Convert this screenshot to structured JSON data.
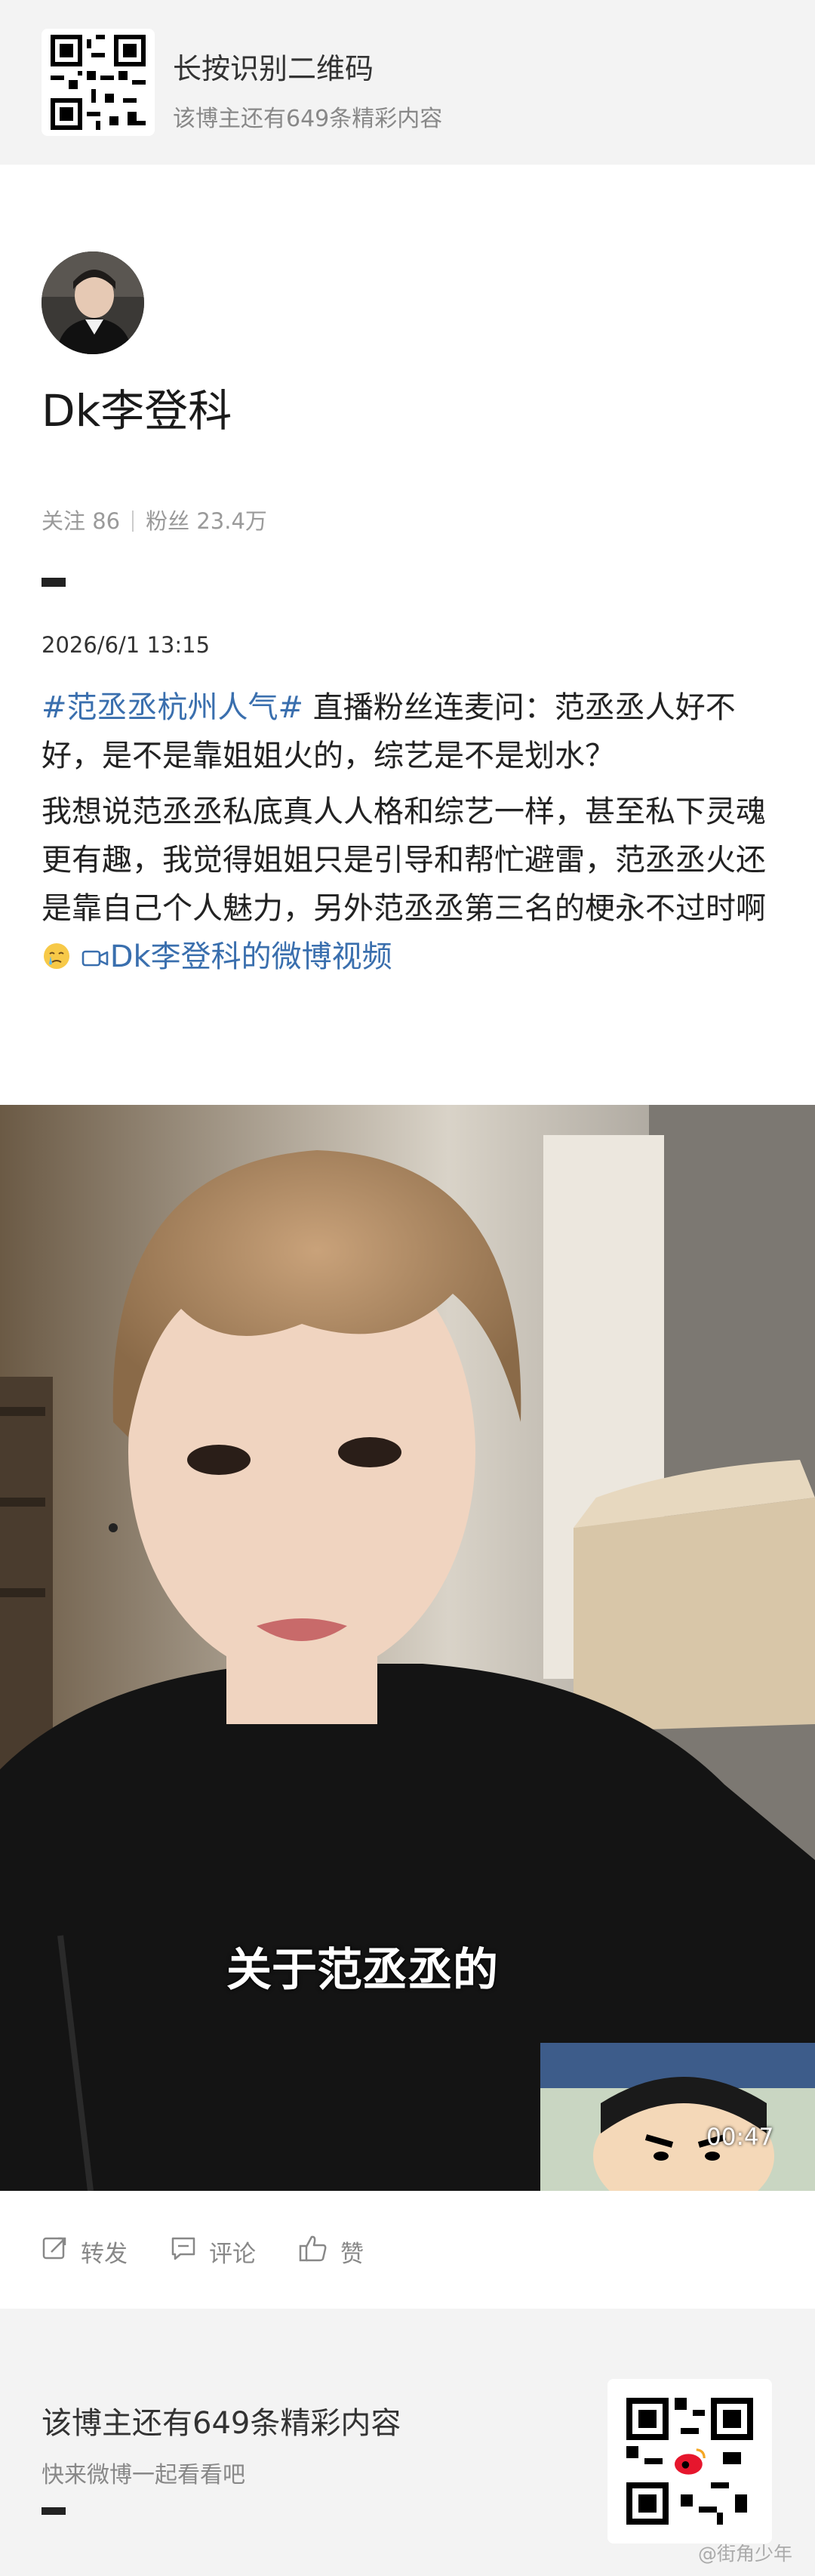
{
  "top_banner": {
    "title": "长按识别二维码",
    "subtitle": "该博主还有649条精彩内容"
  },
  "author": {
    "name": "Dk李登科",
    "follow_label": "关注 86",
    "fans_label": "粉丝 23.4万"
  },
  "post": {
    "date": "2026/6/1 13:15",
    "hashtag": "#范丞丞杭州人气#",
    "paragraph1": " 直播粉丝连麦问：范丞丞人好不好，是不是靠姐姐火的，综艺是不是划水？",
    "paragraph2": "我想说范丞丞私底真人人格和综艺一样，甚至私下灵魂更有趣，我觉得姐姐只是引导和帮忙避雷，范丞丞火还是靠自己个人魅力，另外范丞丞第三名的梗永不过时啊",
    "video_link": "Dk李登科的微博视频"
  },
  "video": {
    "subtitle": "关于范丞丞的",
    "duration": "00:47"
  },
  "actions": {
    "repost": "转发",
    "comment": "评论",
    "like": "赞"
  },
  "bottom_banner": {
    "title": "该博主还有649条精彩内容",
    "subtitle": "快来微博一起看看吧",
    "watermark": "@街角少年"
  },
  "colors": {
    "link": "#3a6fae",
    "banner_bg": "#f3f3f3",
    "muted_text": "#888888"
  }
}
